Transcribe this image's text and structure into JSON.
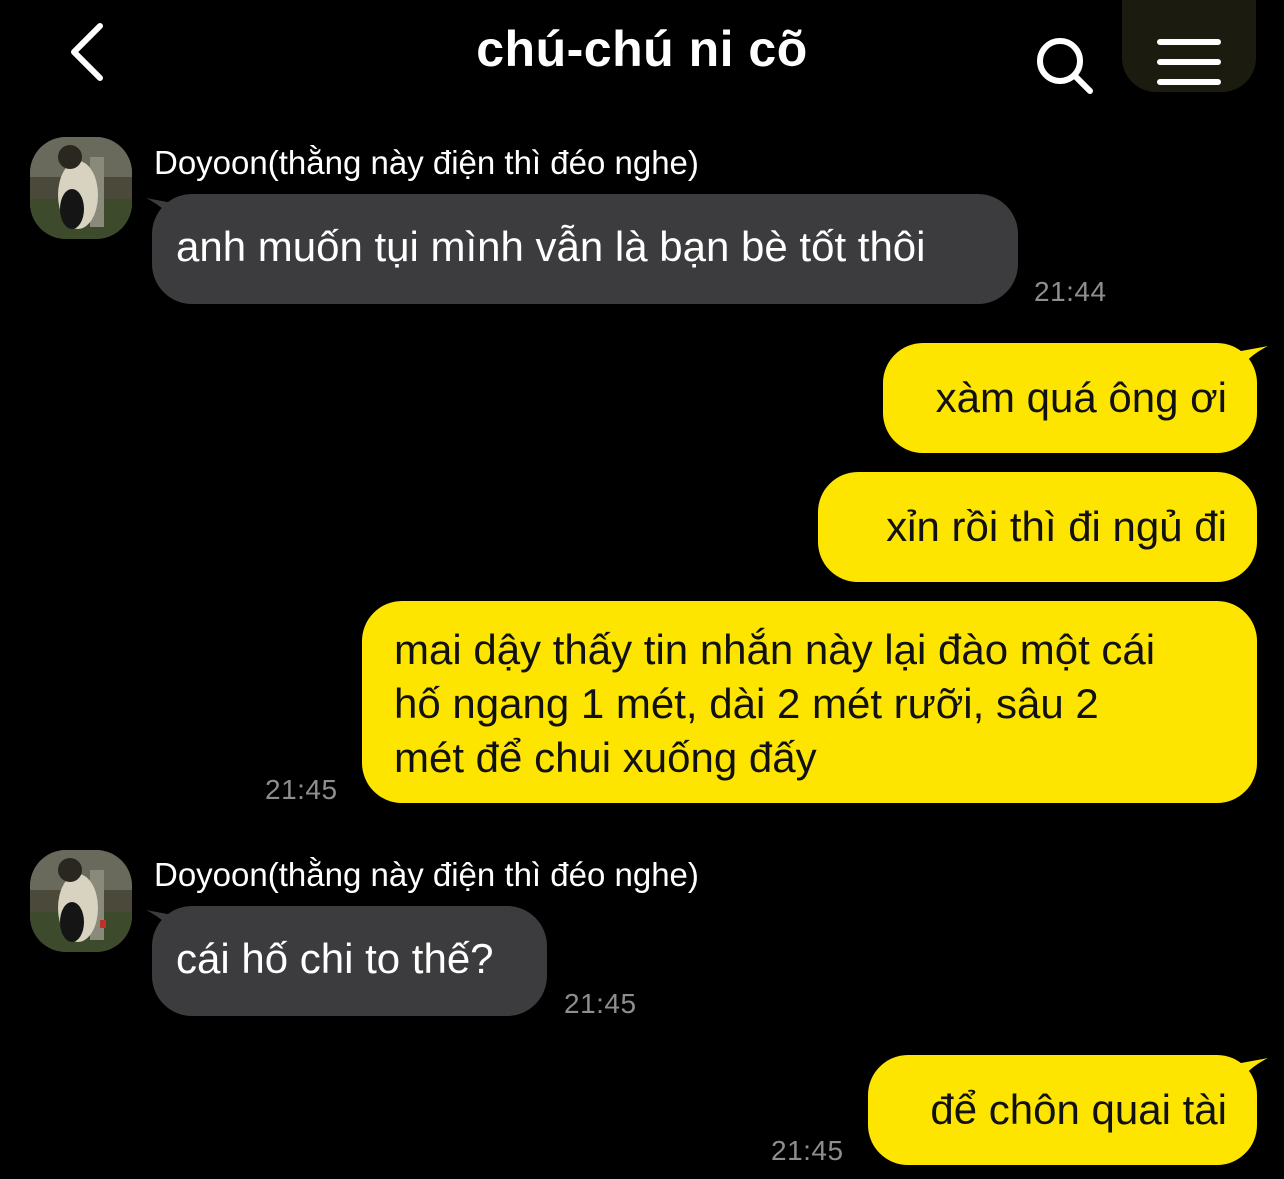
{
  "header": {
    "title": "chú-chú ni cõ",
    "back_icon": "chevron-left-icon",
    "search_icon": "search-icon",
    "menu_icon": "hamburger-menu-icon"
  },
  "colors": {
    "background": "#000000",
    "incoming_bubble": "#3c3c3e",
    "outgoing_bubble": "#fde500",
    "timestamp": "#8e8e8e"
  },
  "messages": [
    {
      "direction": "incoming",
      "sender": "Doyoon(thằng này điện thì đéo nghe)",
      "text": "anh muốn tụi mình vẫn là bạn bè tốt thôi",
      "time": "21:44"
    },
    {
      "direction": "outgoing",
      "text": "xàm quá ông ơi"
    },
    {
      "direction": "outgoing",
      "text": "xỉn rồi thì đi ngủ đi"
    },
    {
      "direction": "outgoing",
      "lines": [
        "mai dậy thấy tin nhắn này lại đào một cái",
        "hố ngang 1 mét, dài 2 mét rưỡi, sâu 2",
        "mét để chui xuống đấy"
      ],
      "time": "21:45"
    },
    {
      "direction": "incoming",
      "sender": "Doyoon(thằng này điện thì đéo nghe)",
      "text": "cái hố chi to thế?",
      "time": "21:45"
    },
    {
      "direction": "outgoing",
      "text": "để chôn quai tài",
      "time": "21:45"
    }
  ]
}
